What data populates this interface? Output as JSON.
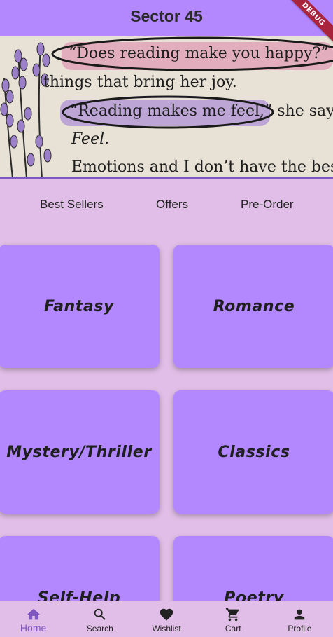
{
  "app_bar": {
    "title": "Sector 45"
  },
  "debug_banner": {
    "label": "DEBUG"
  },
  "banner": {
    "lines": [
      "“Does reading make you happy?”",
      "things that bring her joy.",
      "“Reading makes me feel,” she says",
      "Feel.",
      "Emotions and I don’t have the best"
    ]
  },
  "tabs": [
    {
      "label": "Best Sellers"
    },
    {
      "label": "Offers"
    },
    {
      "label": "Pre-Order"
    }
  ],
  "categories": [
    {
      "label": "Fantasy"
    },
    {
      "label": "Romance"
    },
    {
      "label": "Mystery/Thriller"
    },
    {
      "label": "Classics"
    },
    {
      "label": "Self-Help"
    },
    {
      "label": "Poetry"
    }
  ],
  "bottom_nav": {
    "active": "Home",
    "items": [
      {
        "label": "Home",
        "icon": "home-icon"
      },
      {
        "label": "Search",
        "icon": "search-icon"
      },
      {
        "label": "Wishlist",
        "icon": "heart-icon"
      },
      {
        "label": "Cart",
        "icon": "cart-icon"
      },
      {
        "label": "Profile",
        "icon": "person-icon"
      }
    ]
  },
  "colors": {
    "background": "#e1bee7",
    "primary": "#b388ff",
    "active_nav": "#7e57c2",
    "debug": "#a8233c"
  }
}
